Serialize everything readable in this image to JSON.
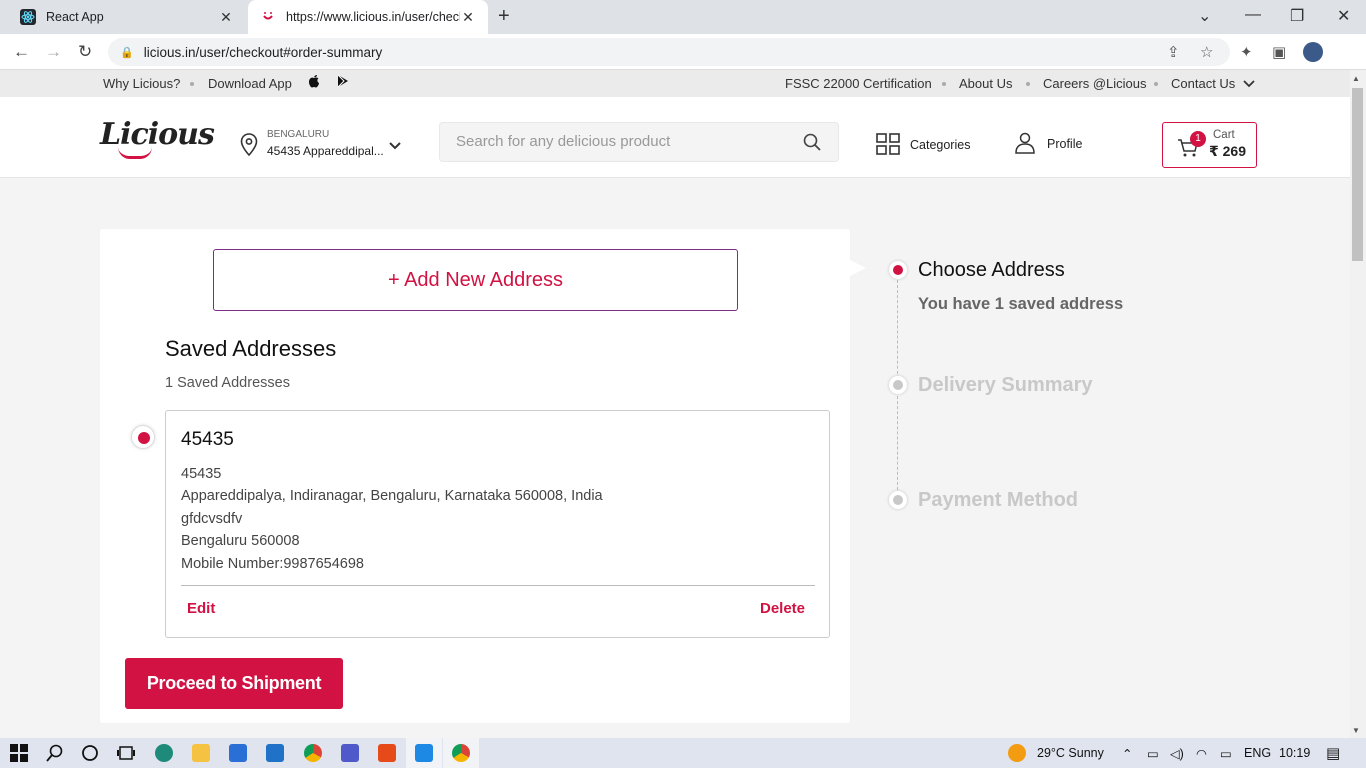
{
  "browser": {
    "tabs": [
      {
        "title": "React App",
        "active": false
      },
      {
        "title": "https://www.licious.in/user/checkout",
        "active": true
      }
    ],
    "url": "licious.in/user/checkout#order-summary"
  },
  "topbar": {
    "left": [
      "Why Licious?",
      "Download App"
    ],
    "right": [
      "FSSC 22000 Certification",
      "About Us",
      "Careers @Licious",
      "Contact Us"
    ]
  },
  "header": {
    "logo": "Licious",
    "location_city": "BENGALURU",
    "location_address": "45435 Appareddipal...",
    "search_placeholder": "Search for any delicious product",
    "categories_label": "Categories",
    "profile_label": "Profile",
    "cart_label": "Cart",
    "cart_count": "1",
    "cart_total": "₹ 269"
  },
  "main": {
    "add_address_label": "+ Add New Address",
    "saved_title": "Saved Addresses",
    "saved_count": "1 Saved Addresses",
    "address": {
      "name": "45435",
      "lines": [
        "45435",
        "Appareddipalya, Indiranagar, Bengaluru, Karnataka 560008, India",
        "gfdcvsdfv",
        "Bengaluru 560008",
        "Mobile Number:9987654698"
      ],
      "edit_label": "Edit",
      "delete_label": "Delete"
    },
    "proceed_label": "Proceed to Shipment"
  },
  "steps": [
    {
      "label": "Choose Address",
      "sub": "You have 1 saved address",
      "active": true
    },
    {
      "label": "Delivery Summary",
      "active": false
    },
    {
      "label": "Payment Method",
      "active": false
    }
  ],
  "taskbar": {
    "weather": "29°C  Sunny",
    "lang": "ENG",
    "time": "10:19"
  },
  "colors": {
    "accent": "#d11243",
    "add_border": "#7b2c84",
    "inactive_step": "#c8c8c8"
  }
}
